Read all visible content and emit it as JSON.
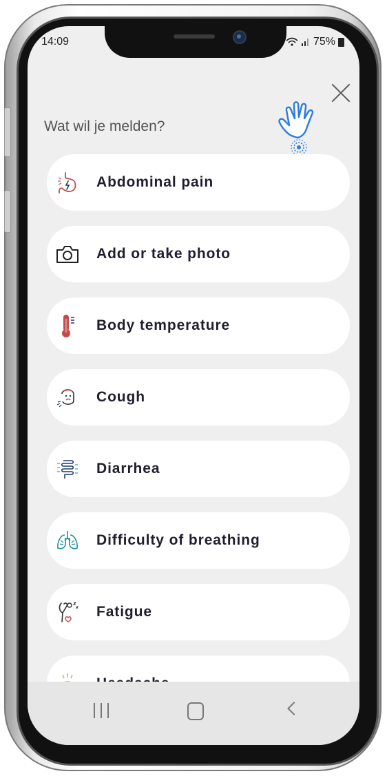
{
  "status_bar": {
    "time": "14:09",
    "battery": "75%"
  },
  "header": {
    "title": "Wat wil je melden?"
  },
  "items": [
    {
      "label": "Abdominal pain",
      "icon": "stomach-icon"
    },
    {
      "label": "Add or take photo",
      "icon": "camera-icon"
    },
    {
      "label": "Body temperature",
      "icon": "thermometer-icon"
    },
    {
      "label": "Cough",
      "icon": "cough-face-icon"
    },
    {
      "label": "Diarrhea",
      "icon": "intestine-icon"
    },
    {
      "label": "Difficulty of breathing",
      "icon": "lungs-icon"
    },
    {
      "label": "Fatigue",
      "icon": "fatigue-icon"
    },
    {
      "label": "Headache",
      "icon": "headache-icon"
    }
  ],
  "colors": {
    "accent": "#2f7de1",
    "background": "#efefef",
    "card": "#ffffff"
  }
}
